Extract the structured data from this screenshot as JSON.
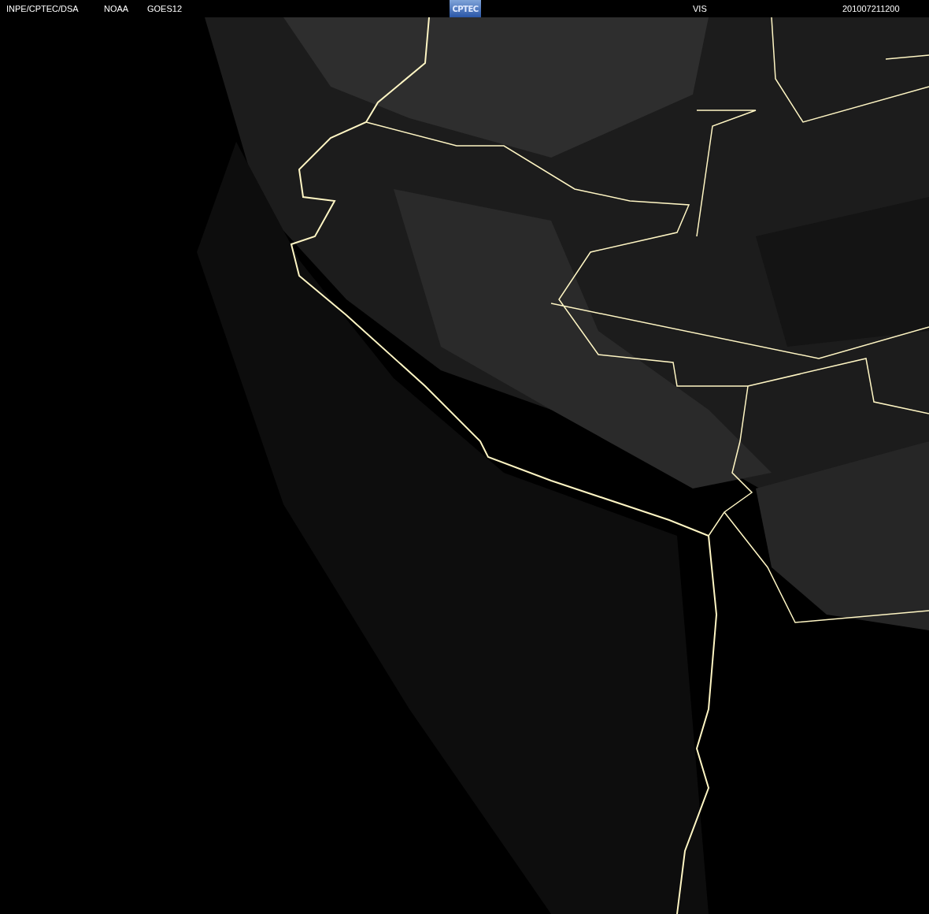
{
  "header": {
    "agency": "INPE/CPTEC/DSA",
    "source": "NOAA",
    "satellite": "GOES12",
    "logo": "CPTEC",
    "channel": "VIS",
    "timestamp": "201007211200"
  }
}
